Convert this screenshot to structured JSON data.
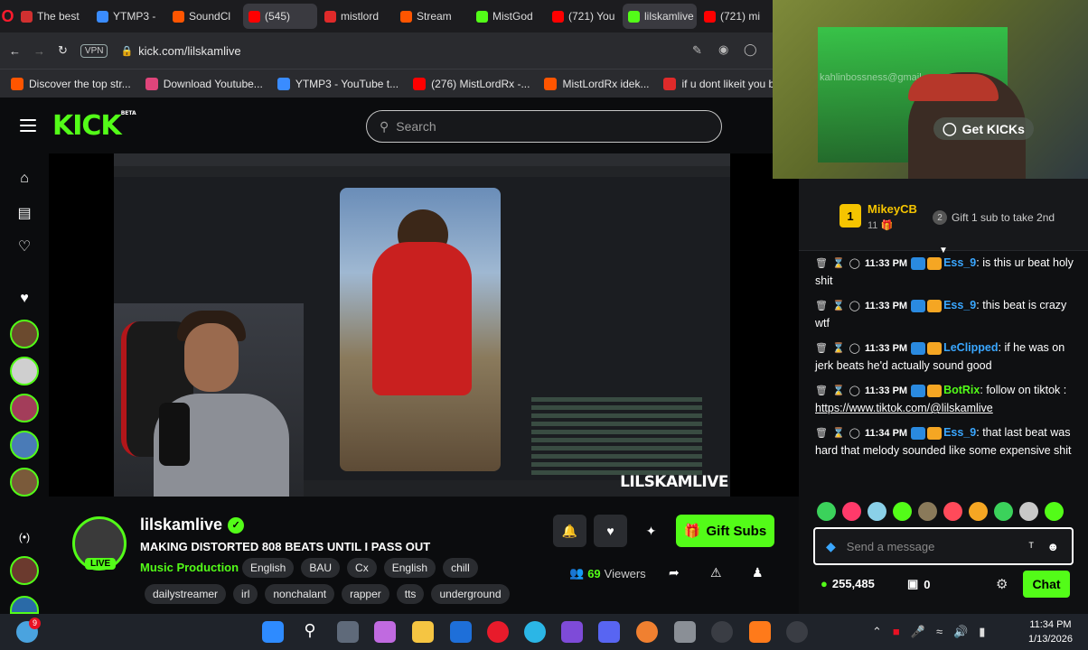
{
  "browser": {
    "tabs": [
      {
        "label": "The best",
        "color": "#d13030",
        "active": false
      },
      {
        "label": "YTMP3 -",
        "color": "#3a8cff",
        "active": false
      },
      {
        "label": "SoundCl",
        "color": "#ff5500",
        "active": false
      },
      {
        "label": "(545)",
        "color": "#ff0000",
        "active": true
      },
      {
        "label": "mistlord",
        "color": "#e02a2a",
        "active": false
      },
      {
        "label": "Stream",
        "color": "#ff5500",
        "active": false
      },
      {
        "label": "MistGod",
        "color": "#53fc18",
        "active": false
      },
      {
        "label": "(721) You",
        "color": "#ff0000",
        "active": false
      },
      {
        "label": "lilskamlive",
        "color": "#53fc18",
        "active": true
      },
      {
        "label": "(721) mi",
        "color": "#ff0000",
        "active": false
      }
    ],
    "url": "kick.com/lilskamlive",
    "vpn_label": "VPN",
    "bookmarks": [
      {
        "label": "Discover the top str...",
        "color": "#ff5500"
      },
      {
        "label": "Download Youtube...",
        "color": "#e0457b"
      },
      {
        "label": "YTMP3 - YouTube t...",
        "color": "#3a8cff"
      },
      {
        "label": "(276) MistLordRx -...",
        "color": "#ff0000"
      },
      {
        "label": "MistLordRx idek...",
        "color": "#ff5500"
      },
      {
        "label": "if u dont likeit you b...",
        "color": "#e02a2a"
      }
    ]
  },
  "kick": {
    "logo": "KICK",
    "logo_sup": "BETA",
    "search_placeholder": "Search",
    "watermark": "LILSKAMLIVE",
    "channel": {
      "name": "lilskamlive",
      "live": "LIVE",
      "title": "MAKING DISTORTED 808 BEATS UNTIL I PASS OUT",
      "category": "Music Production",
      "tags_row1": [
        "English",
        "BAU",
        "Cx",
        "English",
        "chill"
      ],
      "tags_row2": [
        "dailystreamer",
        "irl",
        "nonchalant",
        "rapper",
        "tts",
        "underground"
      ],
      "gift_button": "Gift Subs",
      "viewers_count": "69",
      "viewers_label": "Viewers"
    },
    "webcam_overlay": {
      "get_kicks": "Get KICKs",
      "ghost_email": "kahlinbossness@gmail.com - Gmail"
    },
    "chat": {
      "leader_rank": "1",
      "leader_name": "MikeyCB",
      "leader_count": "11",
      "gift_text": "Gift 1 sub to take 2nd",
      "gift_num": "2",
      "messages": [
        {
          "time": "11:33 PM",
          "user": "Ess_9",
          "user_color": "#3aa7ff",
          "text": "is this ur beat holy shit",
          "link": ""
        },
        {
          "time": "11:33 PM",
          "user": "Ess_9",
          "user_color": "#3aa7ff",
          "text": "this beat is crazy wtf",
          "link": ""
        },
        {
          "time": "11:33 PM",
          "user": "LeClipped",
          "user_color": "#3aa7ff",
          "text": "if he was on jerk beats he'd actually sound good",
          "link": ""
        },
        {
          "time": "11:33 PM",
          "user": "BotRix",
          "user_color": "#53fc18",
          "text": "follow on tiktok : ",
          "link": "https://www.tiktok.com/@lilskamlive"
        },
        {
          "time": "11:34 PM",
          "user": "Ess_9",
          "user_color": "#3aa7ff",
          "text": "that last beat was hard that melody sounded like some expensive shit",
          "link": ""
        }
      ],
      "input_placeholder": "Send a message",
      "points": "255,485",
      "drops": "0",
      "send_label": "Chat"
    }
  },
  "os": {
    "time": "11:34 PM",
    "date": "1/13/2026",
    "notification_badge": "9"
  }
}
